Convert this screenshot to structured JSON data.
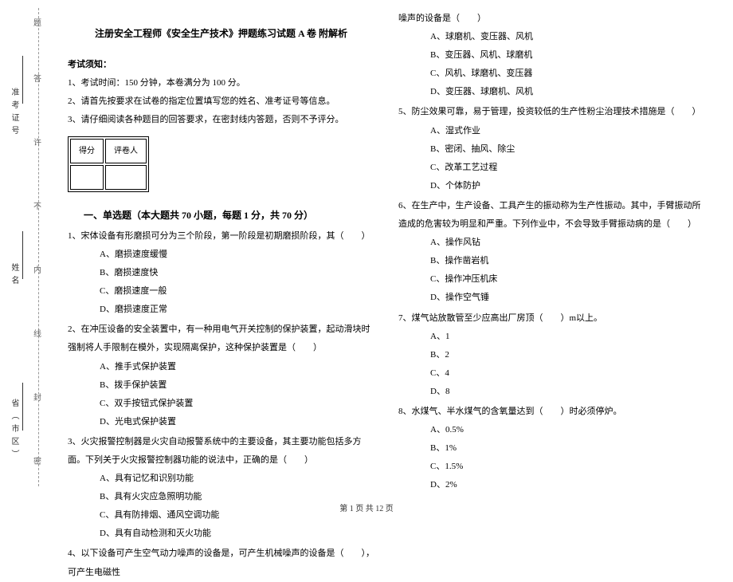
{
  "binding": {
    "province": "省（市区）",
    "name": "姓名",
    "ticket": "准考证号",
    "mark_mi": "密",
    "mark_feng": "封",
    "mark_xian": "线",
    "mark_nei": "内",
    "mark_bu": "不",
    "mark_xu": "许",
    "mark_da": "答",
    "mark_ti": "题"
  },
  "title": "注册安全工程师《安全生产技术》押题练习试题 A 卷 附解析",
  "notice_head": "考试须知：",
  "notice": [
    "1、考试时间：150 分钟，本卷满分为 100 分。",
    "2、请首先按要求在试卷的指定位置填写您的姓名、准考证号等信息。",
    "3、请仔细阅读各种题目的回答要求，在密封线内答题，否则不予评分。"
  ],
  "score_labels": {
    "score": "得分",
    "marker": "评卷人"
  },
  "part1_title": "一、单选题（本大题共 70 小题，每题 1 分，共 70 分）",
  "q1": {
    "stem": "1、宋体设备有形磨损可分为三个阶段，第一阶段是初期磨损阶段，其（　　）",
    "opts": [
      "A、磨损速度缓慢",
      "B、磨损速度快",
      "C、磨损速度一般",
      "D、磨损速度正常"
    ]
  },
  "q2": {
    "stem": "2、在冲压设备的安全装置中，有一种用电气开关控制的保护装置，起动滑块时强制将人手限制在模外，实现隔离保护，这种保护装置是（　　）",
    "opts": [
      "A、推手式保护装置",
      "B、拨手保护装置",
      "C、双手按钮式保护装置",
      "D、光电式保护装置"
    ]
  },
  "q3": {
    "stem": "3、火灾报警控制器是火灾自动报警系统中的主要设备，其主要功能包括多方面。下列关于火灾报警控制器功能的说法中，正确的是（　　）",
    "opts": [
      "A、具有记忆和识别功能",
      "B、具有火灾应急照明功能",
      "C、具有防排烟、通风空调功能",
      "D、具有自动检测和灭火功能"
    ]
  },
  "q4": {
    "stem_a": "4、以下设备可产生空气动力噪声的设备是，可产生机械噪声的设备是（　　），可产生电磁性",
    "stem_b": "噪声的设备是（　　）",
    "opts": [
      "A、球磨机、变压器、风机",
      "B、变压器、风机、球磨机",
      "C、风机、球磨机、变压器",
      "D、变压器、球磨机、风机"
    ]
  },
  "q5": {
    "stem": "5、防尘效果可靠，易于管理，投资较低的生产性粉尘治理技术措施是（　　）",
    "opts": [
      "A、湿式作业",
      "B、密闭、抽风、除尘",
      "C、改革工艺过程",
      "D、个体防护"
    ]
  },
  "q6": {
    "stem": "6、在生产中，生产设备、工具产生的振动称为生产性振动。其中，手臂振动所造成的危害较为明显和严重。下列作业中，不会导致手臂振动病的是（　　）",
    "opts": [
      "A、操作风钻",
      "B、操作凿岩机",
      "C、操作冲压机床",
      "D、操作空气锤"
    ]
  },
  "q7": {
    "stem": "7、煤气站放散管至少应高出厂房顶（　　）m以上。",
    "opts": [
      "A、1",
      "B、2",
      "C、4",
      "D、8"
    ]
  },
  "q8": {
    "stem": "8、水煤气、半水煤气的含氧量达到（　　）时必须停炉。",
    "opts": [
      "A、0.5%",
      "B、1%",
      "C、1.5%",
      "D、2%"
    ]
  },
  "footer": "第 1 页 共 12 页"
}
